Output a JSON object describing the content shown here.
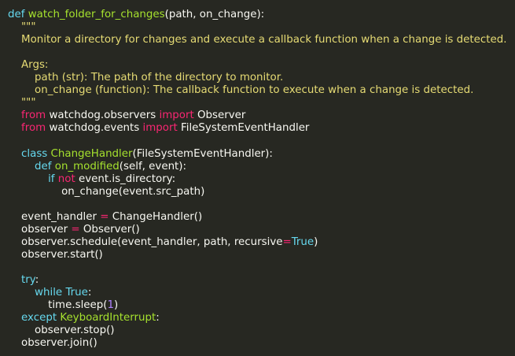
{
  "editor": {
    "background": "#272822",
    "language": "python",
    "colors": {
      "keyword": "#66d9ef",
      "function_name": "#a6e22e",
      "docstring": "#e6db74",
      "import_keyword": "#f92672",
      "operator": "#f92672",
      "number": "#ae81ff",
      "text": "#f8f8f2"
    },
    "lines": [
      [
        [
          "kw",
          "def "
        ],
        [
          "def",
          "watch_folder_for_changes"
        ],
        [
          "text",
          "(path, on_change):"
        ]
      ],
      [
        [
          "doc",
          "    \"\"\""
        ]
      ],
      [
        [
          "doc",
          "    Monitor a directory for changes and execute a callback function when a change is detected."
        ]
      ],
      [],
      [
        [
          "doc",
          "    Args:"
        ]
      ],
      [
        [
          "doc",
          "        path (str): The path of the directory to monitor."
        ]
      ],
      [
        [
          "doc",
          "        on_change (function): The callback function to execute when a change is detected."
        ]
      ],
      [
        [
          "doc",
          "    \"\"\""
        ]
      ],
      [
        [
          "imp",
          "    from "
        ],
        [
          "text",
          "watchdog.observers "
        ],
        [
          "imp",
          "import "
        ],
        [
          "text",
          "Observer"
        ]
      ],
      [
        [
          "imp",
          "    from "
        ],
        [
          "text",
          "watchdog.events "
        ],
        [
          "imp",
          "import "
        ],
        [
          "text",
          "FileSystemEventHandler"
        ]
      ],
      [],
      [
        [
          "kw",
          "    class "
        ],
        [
          "cls",
          "ChangeHandler"
        ],
        [
          "text",
          "(FileSystemEventHandler):"
        ]
      ],
      [
        [
          "kw",
          "        def "
        ],
        [
          "def",
          "on_modified"
        ],
        [
          "text",
          "(self, event):"
        ]
      ],
      [
        [
          "kw",
          "            if "
        ],
        [
          "imp",
          "not "
        ],
        [
          "text",
          "event.is_directory:"
        ]
      ],
      [
        [
          "text",
          "                on_change(event.src_path)"
        ]
      ],
      [],
      [
        [
          "text",
          "    event_handler "
        ],
        [
          "op",
          "= "
        ],
        [
          "text",
          "ChangeHandler()"
        ]
      ],
      [
        [
          "text",
          "    observer "
        ],
        [
          "op",
          "= "
        ],
        [
          "text",
          "Observer()"
        ]
      ],
      [
        [
          "text",
          "    observer.schedule(event_handler, path, recursive"
        ],
        [
          "op",
          "="
        ],
        [
          "kw",
          "True"
        ],
        [
          "text",
          ")"
        ]
      ],
      [
        [
          "text",
          "    observer.start()"
        ]
      ],
      [],
      [
        [
          "kw",
          "    try"
        ],
        [
          "text",
          ":"
        ]
      ],
      [
        [
          "kw",
          "        while "
        ],
        [
          "kw",
          "True"
        ],
        [
          "text",
          ":"
        ]
      ],
      [
        [
          "text",
          "            time.sleep("
        ],
        [
          "num",
          "1"
        ],
        [
          "text",
          ")"
        ]
      ],
      [
        [
          "kw",
          "    except "
        ],
        [
          "cls",
          "KeyboardInterrupt"
        ],
        [
          "text",
          ":"
        ]
      ],
      [
        [
          "text",
          "        observer.stop()"
        ]
      ],
      [
        [
          "text",
          "    observer.join()"
        ]
      ]
    ]
  }
}
